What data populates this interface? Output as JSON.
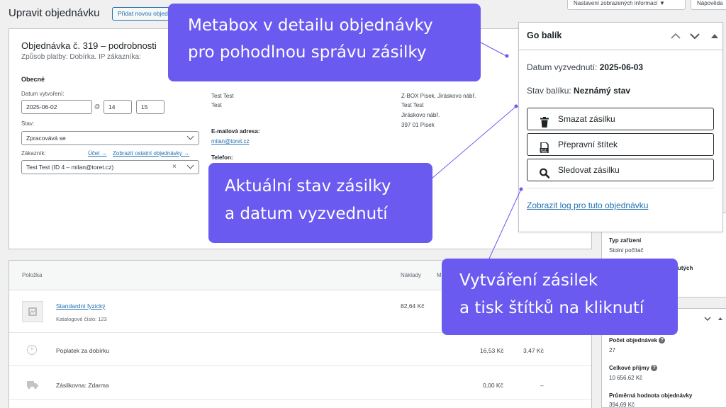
{
  "header": {
    "page_title": "Upravit objednávku",
    "add_new": "Přidat novou objednávku",
    "screen_options": "Nastavení zobrazených informací ▼",
    "help": "Nápověda"
  },
  "order": {
    "title": "Objednávka č. 319 – podrobnosti",
    "meta": "Způsob platby: Dobírka. IP zákazníka:",
    "general_heading": "Obecné",
    "date_label": "Datum vytvoření:",
    "date_value": "2025-06-02",
    "at": "@",
    "hour": "14",
    "minute": "15",
    "status_label": "Stav:",
    "status_value": "Zpracovává se",
    "customer_label": "Zákazník:",
    "account_link": "Účet →",
    "other_orders_link": "Zobrazit ostatní objednávky →",
    "customer_value": "Test Test (ID 4 – milan@toret.cz)",
    "billing": {
      "name_1": "Test Test",
      "name_2": "Test",
      "email_label": "E-mailová adresa:",
      "email": "milan@toret.cz",
      "phone_label": "Telefon:"
    },
    "shipping": {
      "line_1": "Z-BOX Písek, Jiráskovo nábř.",
      "line_2": "Test Test",
      "line_3": "Jiráskovo nábř.",
      "line_4": "397 01 Písek"
    }
  },
  "items": {
    "col_item": "Položka",
    "col_cost": "Náklady",
    "col_m": "M",
    "rows": [
      {
        "name": "Standardní fyzický",
        "sku": "Katalogové číslo: 123",
        "cost": "82,64 Kč"
      },
      {
        "name": "Poplatek za dobírku",
        "total": "16,53 Kč",
        "tax": "3,47 Kč"
      },
      {
        "name": "Zásilkovna: Zdarma",
        "total": "0,00 Kč",
        "tax": "–"
      }
    ]
  },
  "sidebar": {
    "device_label": "Typ zařízení",
    "device_value": "Stolní počítač",
    "partial": "utých",
    "orders_count_label": "Počet objednávek",
    "orders_count": "27",
    "revenue_label": "Celkové příjmy",
    "revenue": "10 656,62 Kč",
    "avg_label": "Průměrná hodnota objednávky",
    "avg": "394,69 Kč"
  },
  "gobalik": {
    "title": "Go balík",
    "pickup_label": "Datum vyzvednutí:",
    "pickup_date": "2025-06-03",
    "status_label": "Stav balíku:",
    "status_value": "Neznámý stav",
    "btn_delete": "Smazat zásilku",
    "btn_label": "Přepravní štítek",
    "btn_track": "Sledovat zásilku",
    "log_link": "Zobrazit log pro tuto objednávku"
  },
  "callouts": {
    "c1_line1": "Metabox v detailu objednávky",
    "c1_line2": "pro pohodlnou správu zásilky",
    "c2_line1": "Aktuální stav zásilky",
    "c2_line2": "a datum vyzvednutí",
    "c3_line1": "Vytváření zásilek",
    "c3_line2": "a tisk štítků na kliknutí"
  },
  "colors": {
    "accent": "#2271b1",
    "callout": "#6a5af0"
  }
}
